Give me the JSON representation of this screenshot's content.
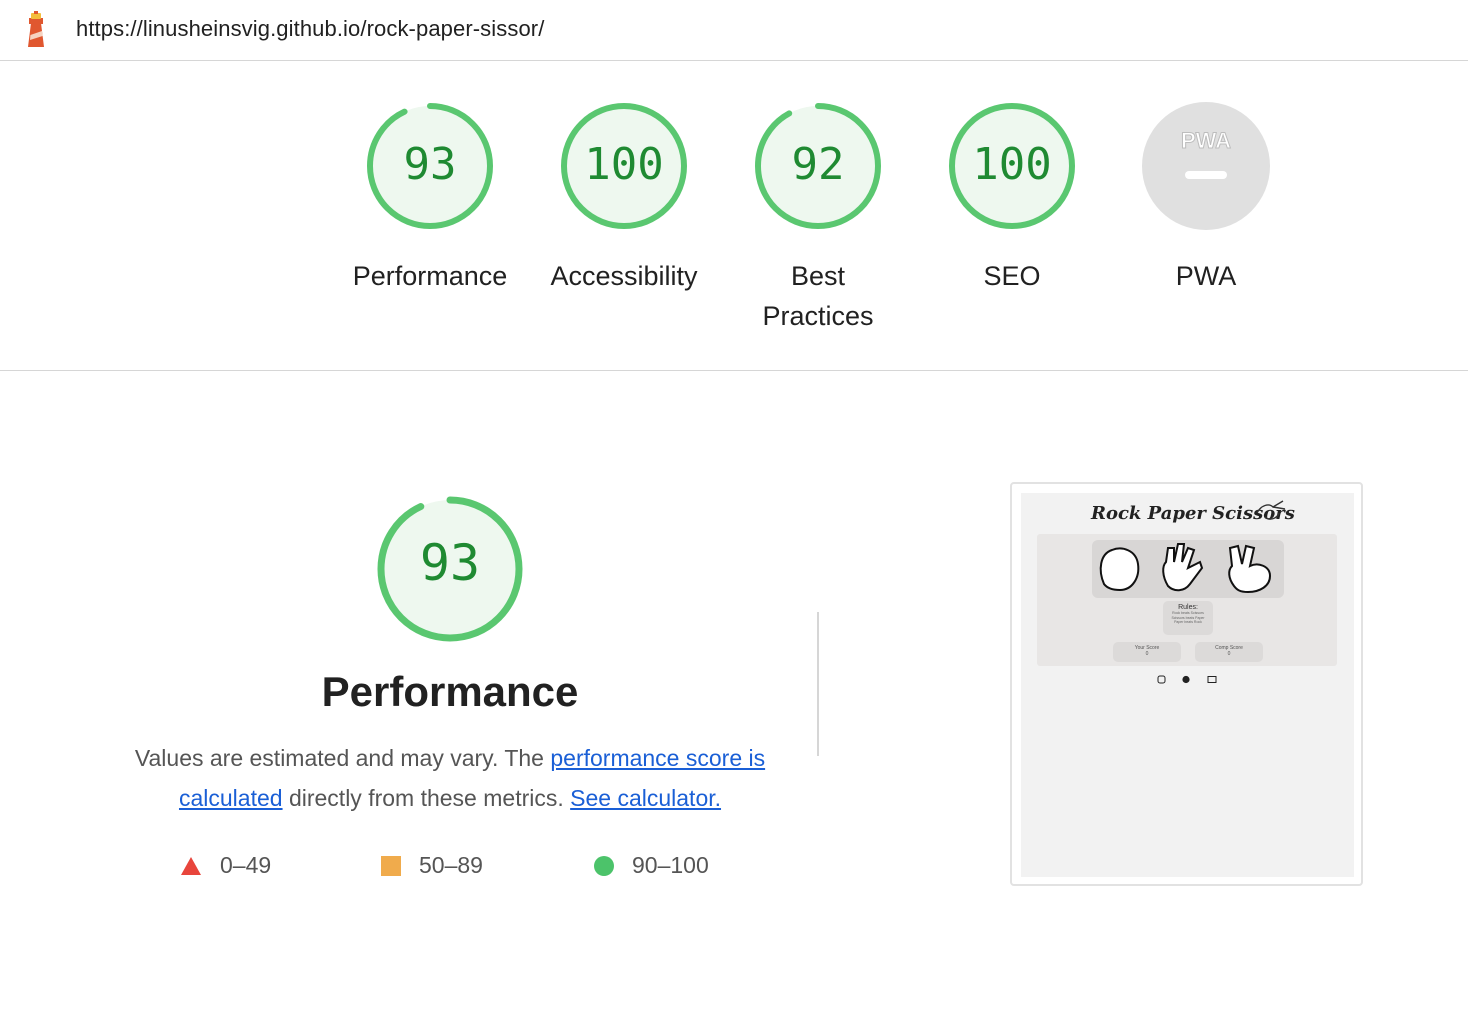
{
  "topbar": {
    "url": "https://linusheinsvig.github.io/rock-paper-sissor/",
    "icon": "lighthouse-icon"
  },
  "categories": [
    {
      "key": "performance",
      "score": "93",
      "label": "Performance",
      "fraction": 0.93
    },
    {
      "key": "accessibility",
      "score": "100",
      "label": "Accessibility",
      "fraction": 1.0
    },
    {
      "key": "best-practices",
      "score": "92",
      "label_line1": "Best",
      "label_line2": "Practices",
      "fraction": 0.92
    },
    {
      "key": "seo",
      "score": "100",
      "label": "SEO",
      "fraction": 1.0
    },
    {
      "key": "pwa",
      "badge": "PWA",
      "label": "PWA"
    }
  ],
  "performance": {
    "score": "93",
    "fraction": 0.93,
    "title": "Performance",
    "desc_prefix": "Values are estimated and may vary. The ",
    "link_score": "performance score is calculated",
    "desc_mid": " directly from these metrics. ",
    "link_calc": "See calculator.",
    "legend": [
      {
        "icon": "triangle-red-icon",
        "range": "0–49"
      },
      {
        "icon": "square-orange-icon",
        "range": "50–89"
      },
      {
        "icon": "circle-green-icon",
        "range": "90–100"
      }
    ]
  },
  "thumbnail": {
    "app_title": "Rock Paper Scissors",
    "rules_title": "Rules:",
    "rules_lines": [
      "Rock beats Scissors",
      "Scissors beats Paper",
      "Paper beats Rock"
    ],
    "your_score_label": "Your Score",
    "comp_score_label": "Comp Score",
    "your_score": "0",
    "comp_score": "0"
  },
  "colors": {
    "pass": "#0cce6b",
    "pass_ring": "#5ac770",
    "pass_fill": "#eef8ef",
    "pass_text": "#1f8a32",
    "average": "#f0ab4c",
    "fail": "#e8453c",
    "link": "#1a5fd6",
    "na": "#e0e0e0"
  }
}
